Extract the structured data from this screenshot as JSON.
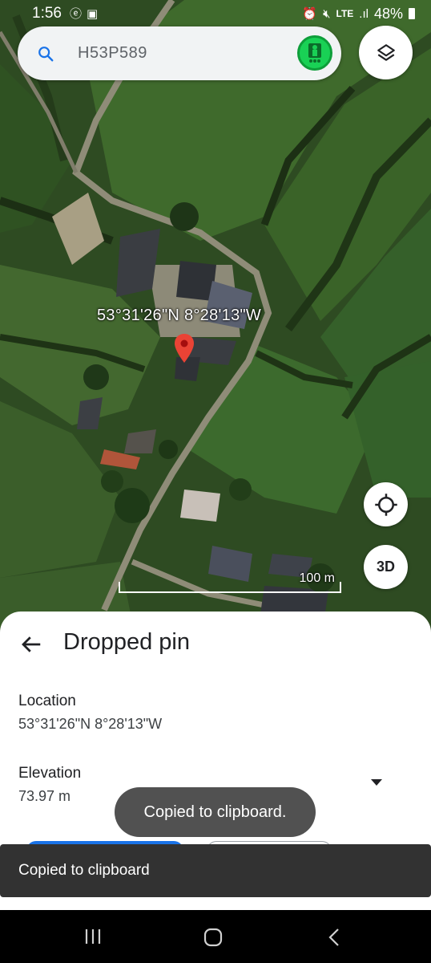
{
  "status_bar": {
    "time": "1:56",
    "network_type": "LTE",
    "battery": "48%"
  },
  "search": {
    "query": "H53P589"
  },
  "map": {
    "dropped_pin_coordinates": "53°31'26\"N 8°28'13\"W",
    "scale_label": "100 m",
    "three_d_label": "3D"
  },
  "sheet": {
    "title": "Dropped pin",
    "location_heading": "Location",
    "location_value": "53°31'26\"N 8°28'13\"W",
    "elevation_heading": "Elevation",
    "elevation_value": "73.97 m"
  },
  "toast": {
    "message": "Copied to clipboard."
  },
  "snackbar": {
    "message": "Copied to clipboard"
  },
  "colors": {
    "accent_blue": "#1a73e8",
    "pin_red": "#ea4335",
    "avatar_green": "#19d155"
  },
  "icons": [
    "search-icon",
    "avatar-icon",
    "layers-icon",
    "map-pin-icon",
    "my-location-icon",
    "back-arrow-icon",
    "chevron-down-icon",
    "recents-icon",
    "home-icon",
    "back-nav-icon"
  ]
}
